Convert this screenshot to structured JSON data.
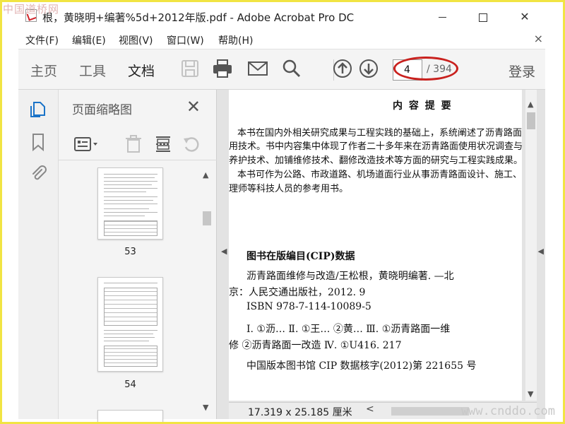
{
  "watermark": {
    "top_left": "中国道桥网",
    "bottom_right": "www.cnddo.com"
  },
  "window": {
    "title": "根，黄晓明+编著%5d+2012年版.pdf - Adobe Acrobat Pro DC",
    "controls": {
      "minimize": "minimize",
      "maximize": "maximize",
      "close": "✕"
    }
  },
  "menu": {
    "items": [
      "文件(F)",
      "编辑(E)",
      "视图(V)",
      "窗口(W)",
      "帮助(H)"
    ],
    "close": "×"
  },
  "toolbar": {
    "tabs": [
      "主页",
      "工具",
      "文档"
    ],
    "active_tab": "文档",
    "page_current": "4",
    "page_total": "/ 394",
    "login": "登录",
    "icons": [
      "save-icon",
      "print-icon",
      "email-icon",
      "search-icon",
      "page-up-icon",
      "page-down-icon"
    ]
  },
  "rail": {
    "icons": [
      "page-thumbnails-icon",
      "bookmark-icon",
      "attachment-icon"
    ]
  },
  "thumbnails_panel": {
    "title": "页面缩略图",
    "close": "✕",
    "tools": [
      "thumbnail-options-icon",
      "delete-page-icon",
      "extract-page-icon",
      "rotate-page-icon"
    ],
    "pages": [
      {
        "label": "53"
      },
      {
        "label": "54"
      }
    ]
  },
  "document": {
    "heading": "内 容 提 要",
    "summary_lines": [
      "本书在国内外相关研究成果与工程实践的基础上，系统阐述了沥青路面维",
      "用技术。书中内容集中体现了作者二十多年来在沥青路面使用状况调查与",
      "养护技术、加铺维修技术、翻修改造技术等方面的研究与工程实践成果。",
      "本书可作为公路、市政道路、机场道面行业从事沥青路面设计、施工、养护",
      "理师等科技人员的参考用书。"
    ],
    "cip_title": "图书在版编目(CIP)数据",
    "cip_lines": [
      "沥青路面维修与改造/王松根，黄晓明编著. —北",
      "京：人民交通出版社，2012. 9",
      "ISBN  978-7-114-10089-5",
      "Ⅰ. ①沥…   Ⅱ. ①王…  ②黄…   Ⅲ. ①沥青路面一维",
      "修 ②沥青路面一改造   Ⅳ. ①U416. 217",
      "中国版本图书馆 CIP 数据核字(2012)第 221655 号"
    ]
  },
  "status": {
    "page_size": "17.319 x 25.185 厘米",
    "scroll_left": "<"
  },
  "colors": {
    "accent": "#1a73c8",
    "annotation": "#c9211e",
    "frame": "#f1e443"
  }
}
